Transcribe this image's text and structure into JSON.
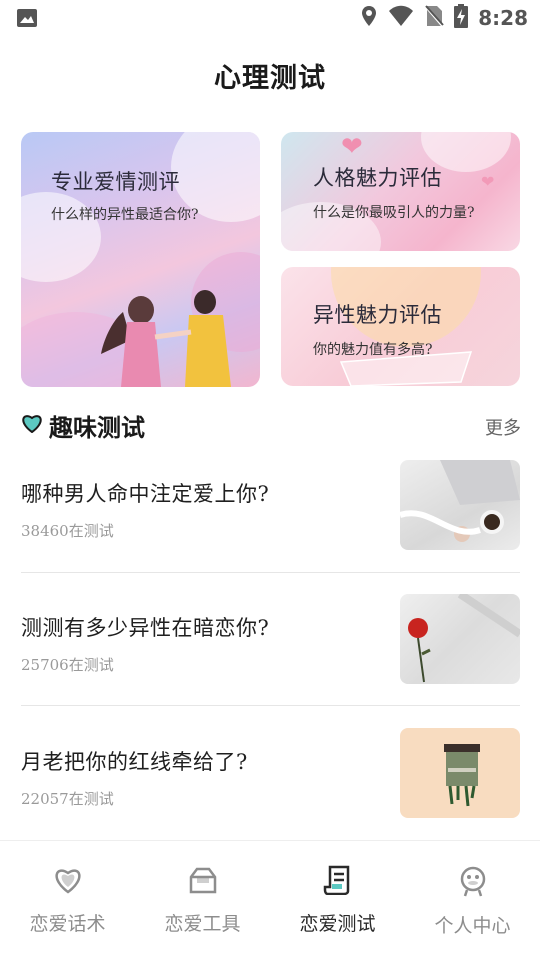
{
  "status_bar": {
    "time": "8:28"
  },
  "page": {
    "title": "心理测试"
  },
  "banners": [
    {
      "title": "专业爱情测评",
      "subtitle": "什么样的异性最适合你?"
    },
    {
      "title": "人格魅力评估",
      "subtitle": "什么是你最吸引人的力量?"
    },
    {
      "title": "异性魅力评估",
      "subtitle": "你的魅力值有多高?"
    }
  ],
  "section": {
    "title": "趣味测试",
    "more": "更多"
  },
  "quizzes": [
    {
      "title": "哪种男人命中注定爱上你?",
      "count": "38460在测试"
    },
    {
      "title": "测测有多少异性在暗恋你?",
      "count": "25706在测试"
    },
    {
      "title": "月老把你的红线牵给了?",
      "count": "22057在测试"
    }
  ],
  "nav": [
    {
      "label": "恋爱话术",
      "icon": "heart-icon"
    },
    {
      "label": "恋爱工具",
      "icon": "toolbox-icon"
    },
    {
      "label": "恋爱测试",
      "icon": "quiz-doc-icon",
      "active": true
    },
    {
      "label": "个人中心",
      "icon": "profile-icon"
    }
  ]
}
